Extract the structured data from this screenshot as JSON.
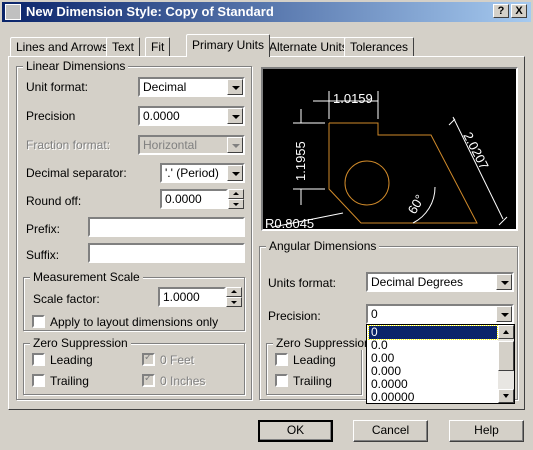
{
  "window": {
    "title": "New Dimension Style: Copy of Standard",
    "help_btn": "?",
    "close_btn": "X"
  },
  "tabs": [
    {
      "label": "Lines and Arrows"
    },
    {
      "label": "Text"
    },
    {
      "label": "Fit"
    },
    {
      "label": "Primary Units",
      "active": true
    },
    {
      "label": "Alternate Units"
    },
    {
      "label": "Tolerances"
    }
  ],
  "linear": {
    "group_label": "Linear Dimensions",
    "unit_format_label": "Unit format:",
    "unit_format_value": "Decimal",
    "precision_label": "Precision",
    "precision_value": "0.0000",
    "fraction_format_label": "Fraction format:",
    "fraction_format_value": "Horizontal",
    "decimal_sep_label": "Decimal separator:",
    "decimal_sep_value": "'.' (Period)",
    "round_off_label": "Round off:",
    "round_off_value": "0.0000",
    "prefix_label": "Prefix:",
    "prefix_value": "",
    "suffix_label": "Suffix:",
    "suffix_value": ""
  },
  "measurement": {
    "group_label": "Measurement Scale",
    "scale_label": "Scale factor:",
    "scale_value": "1.0000",
    "apply_layout_label": "Apply to layout dimensions only"
  },
  "zero_linear": {
    "group_label": "Zero Suppression",
    "leading": "Leading",
    "trailing": "Trailing",
    "feet": "0 Feet",
    "inches": "0 Inches"
  },
  "preview": {
    "dim_top": "1.0159",
    "dim_left": "1.1955",
    "dim_right": "2.0207",
    "angle": "60°",
    "radius": "R0.8045",
    "line_color": "#d08a2a",
    "dim_color": "#ffffff"
  },
  "angular": {
    "group_label": "Angular Dimensions",
    "units_format_label": "Units format:",
    "units_format_value": "Decimal Degrees",
    "precision_label": "Precision:",
    "precision_value": "0",
    "zero_group_label": "Zero Suppression",
    "leading": "Leading",
    "trailing": "Trailing",
    "precision_options": [
      "0",
      "0.0",
      "0.00",
      "0.000",
      "0.0000",
      "0.00000"
    ]
  },
  "buttons": {
    "ok": "OK",
    "cancel": "Cancel",
    "help": "Help"
  },
  "colors": {
    "titlebar_start": "#0a246a",
    "selection": "#0a246a",
    "face": "#d4d0c8"
  }
}
